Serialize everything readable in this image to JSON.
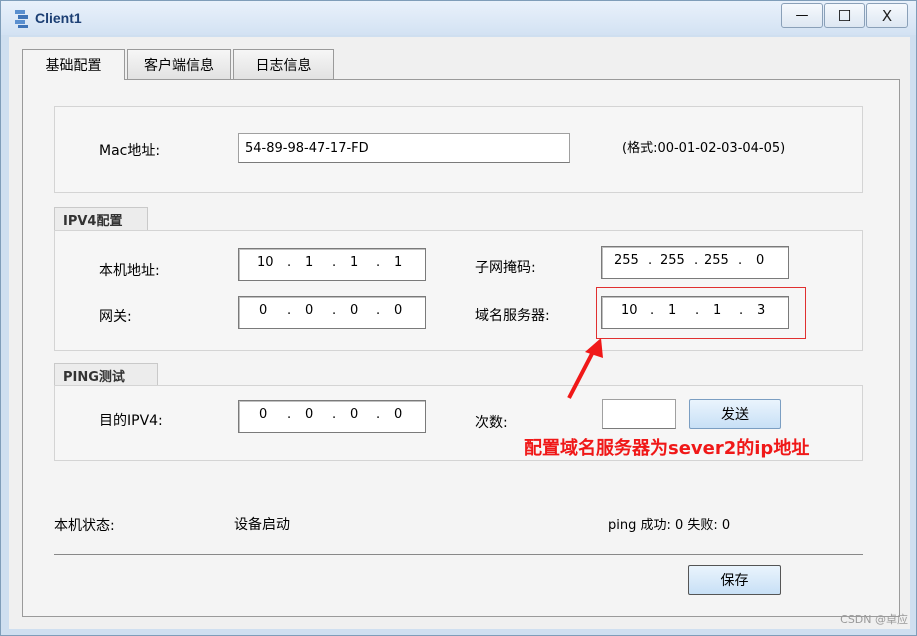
{
  "window": {
    "title": "Client1",
    "minimize_glyph": "—",
    "maximize_glyph": "☐",
    "close_glyph": "X"
  },
  "tabs": [
    {
      "label": "基础配置",
      "active": true
    },
    {
      "label": "客户端信息",
      "active": false
    },
    {
      "label": "日志信息",
      "active": false
    }
  ],
  "mac": {
    "label": "Mac地址:",
    "value": "54-89-98-47-17-FD",
    "format_hint": "(格式:00-01-02-03-04-05)"
  },
  "ipv4": {
    "group_title": "IPV4配置",
    "ip": {
      "label": "本机地址:",
      "octets": [
        "10",
        "1",
        "1",
        "1"
      ]
    },
    "mask": {
      "label": "子网掩码:",
      "octets": [
        "255",
        "255",
        "255",
        "0"
      ]
    },
    "gateway": {
      "label": "网关:",
      "octets": [
        "0",
        "0",
        "0",
        "0"
      ]
    },
    "dns": {
      "label": "域名服务器:",
      "octets": [
        "10",
        "1",
        "1",
        "3"
      ]
    }
  },
  "ping": {
    "group_title": "PING测试",
    "target": {
      "label": "目的IPV4:",
      "octets": [
        "0",
        "0",
        "0",
        "0"
      ]
    },
    "count_label": "次数:",
    "count_value": "",
    "send_button": "发送"
  },
  "annotation": {
    "text": "配置域名服务器为sever2的ip地址",
    "color": "#f01818"
  },
  "status": {
    "label": "本机状态:",
    "value": "设备启动",
    "ping_result": "ping 成功: 0 失败: 0"
  },
  "save_button": "保存",
  "watermark": "CSDN @卓应"
}
